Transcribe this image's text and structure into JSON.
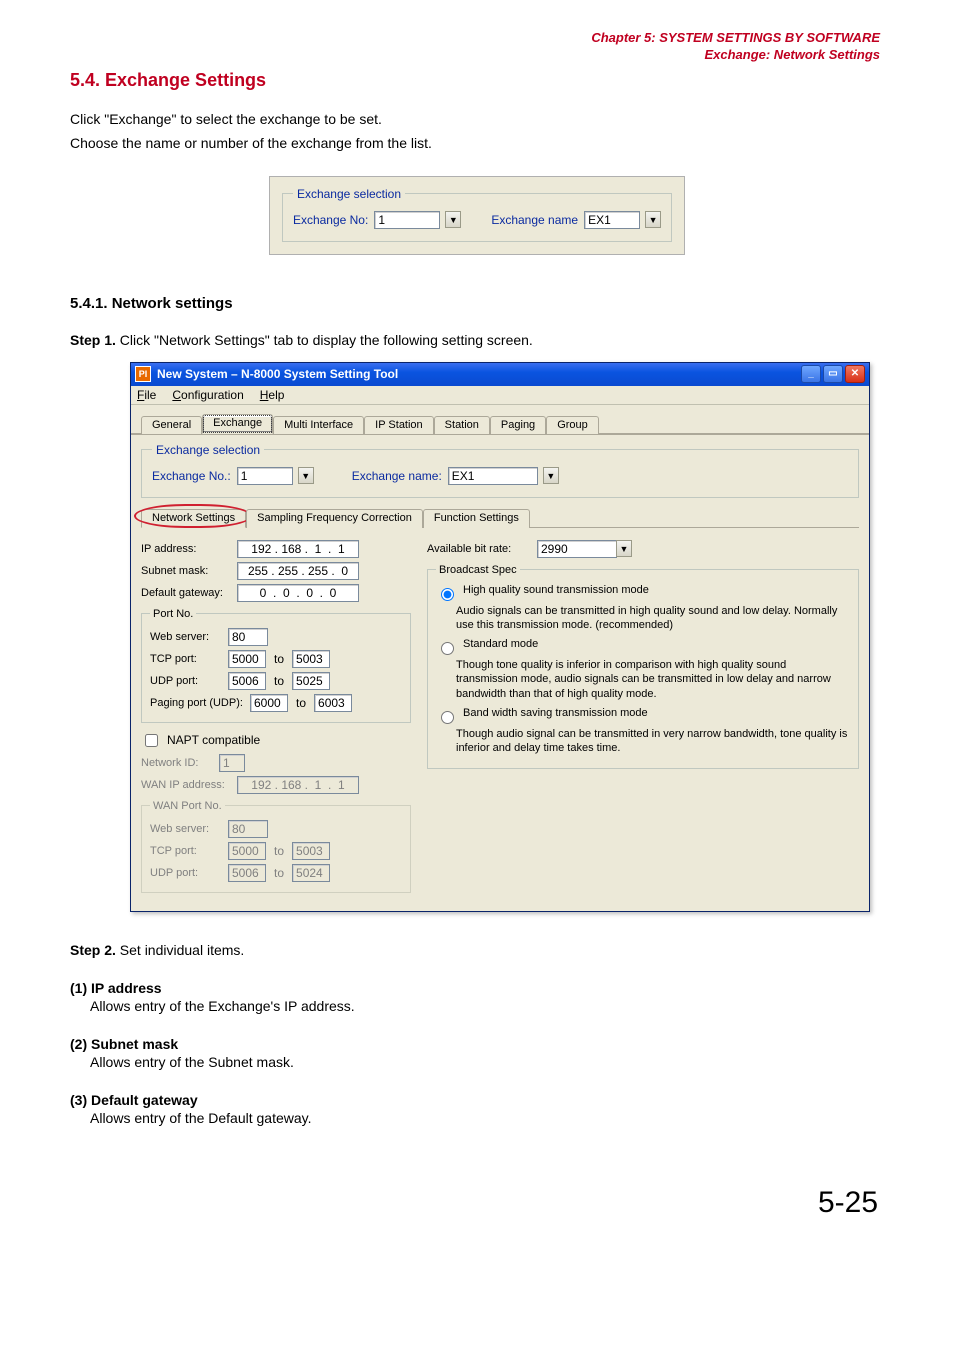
{
  "header": {
    "chapter": "Chapter 5:  SYSTEM SETTINGS BY SOFTWARE",
    "subchapter": "Exchange: Network Settings"
  },
  "sec54": {
    "title": "5.4. Exchange Settings",
    "line1": "Click \"Exchange\" to select the exchange to be set.",
    "line2": "Choose the name or number of the exchange from the list."
  },
  "fig1": {
    "legend": "Exchange selection",
    "noLabel": "Exchange No:",
    "noValue": "1",
    "nameLabel": "Exchange name",
    "nameValue": "EX1"
  },
  "sec541": {
    "title": "5.4.1. Network settings",
    "step1_label": "Step 1.",
    "step1_text": "Click \"Network Settings\" tab to display the following setting screen.",
    "step2_label": "Step 2.",
    "step2_text": "Set individual items."
  },
  "app": {
    "title": "New System – N-8000 System Setting Tool",
    "menu": {
      "file": "File",
      "config": "Configuration",
      "help": "Help"
    },
    "tabs": {
      "general": "General",
      "exchange": "Exchange",
      "multi": "Multi Interface",
      "ipstation": "IP Station",
      "station": "Station",
      "paging": "Paging",
      "group": "Group"
    },
    "exchSel": {
      "legend": "Exchange selection",
      "noLabel": "Exchange No.:",
      "noValue": "1",
      "nameLabel": "Exchange name:",
      "nameValue": "EX1"
    },
    "subtabs": {
      "network": "Network Settings",
      "sfc": "Sampling Frequency Correction",
      "func": "Function Settings"
    },
    "left": {
      "ipLabel": "IP address:",
      "ipValue": "192 . 168 .  1  .  1",
      "maskLabel": "Subnet mask:",
      "maskValue": "255 . 255 . 255 .  0",
      "gwLabel": "Default gateway:",
      "gwValue": "0  .  0  .  0  .  0",
      "portLegend": "Port No.",
      "webLabel": "Web server:",
      "webValue": "80",
      "tcpLabel": "TCP port:",
      "tcp1": "5000",
      "to": "to",
      "tcp2": "5003",
      "udpLabel": "UDP port:",
      "udp1": "5006",
      "udp2": "5025",
      "pagingLabel": "Paging port (UDP):",
      "pag1": "6000",
      "pag2": "6003",
      "naptLabel": "NAPT compatible",
      "nidLabel": "Network ID:",
      "nidValue": "1",
      "wanipLabel": "WAN IP address:",
      "wanipValue": "192 . 168 .  1  .  1",
      "wanLegend": "WAN Port No.",
      "wanWebLabel": "Web server:",
      "wanWebValue": "80",
      "wanTcpLabel": "TCP port:",
      "wanTcp1": "5000",
      "wanTcp2": "5003",
      "wanUdpLabel": "UDP port:",
      "wanUdp1": "5006",
      "wanUdp2": "5024"
    },
    "right": {
      "bitrateLabel": "Available bit rate:",
      "bitrateValue": "2990",
      "bspecLegend": "Broadcast Spec",
      "hqLabel": "High quality sound transmission mode",
      "hqDesc": "Audio signals can be transmitted in high quality sound and low delay. Normally use this transmission mode. (recommended)",
      "stdLabel": "Standard mode",
      "stdDesc": "Though tone quality is inferior in comparison with high quality sound transmission mode, audio signals can be transmitted in low delay and narrow bandwidth than that of high quality mode.",
      "bwLabel": "Band width saving transmission mode",
      "bwDesc": "Though audio signal can be transmitted in very narrow bandwidth, tone quality is inferior and delay time takes time."
    }
  },
  "items": {
    "i1_num": "(1)",
    "i1_title": "IP address",
    "i1_text": "Allows entry of the Exchange's IP address.",
    "i2_num": "(2)",
    "i2_title": "Subnet mask",
    "i2_text": "Allows entry of the Subnet mask.",
    "i3_num": "(3)",
    "i3_title": "Default gateway",
    "i3_text": "Allows entry of the Default gateway."
  },
  "pagenum": "5-25"
}
